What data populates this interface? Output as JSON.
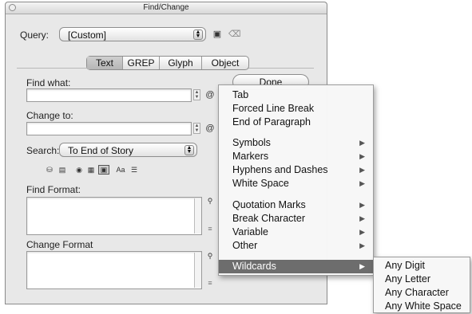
{
  "window": {
    "title": "Find/Change"
  },
  "query": {
    "label": "Query:",
    "value": "[Custom]"
  },
  "tabs": [
    {
      "label": "Text",
      "active": true
    },
    {
      "label": "GREP",
      "active": false
    },
    {
      "label": "Glyph",
      "active": false
    },
    {
      "label": "Object",
      "active": false
    }
  ],
  "find_what": {
    "label": "Find what:",
    "value": ""
  },
  "change_to": {
    "label": "Change to:",
    "value": ""
  },
  "search": {
    "label": "Search:",
    "value": "To End of Story"
  },
  "find_format": {
    "label": "Find Format:"
  },
  "change_format": {
    "label": "Change Format"
  },
  "buttons": {
    "done": "Done"
  },
  "option_icons": {
    "case_label": "Aa"
  },
  "special_menu": {
    "items": [
      {
        "label": "Tab",
        "submenu": false
      },
      {
        "label": "Forced Line Break",
        "submenu": false
      },
      {
        "label": "End of Paragraph",
        "submenu": false
      },
      {
        "label": "Symbols",
        "submenu": true
      },
      {
        "label": "Markers",
        "submenu": true
      },
      {
        "label": "Hyphens and Dashes",
        "submenu": true
      },
      {
        "label": "White Space",
        "submenu": true
      },
      {
        "label": "Quotation Marks",
        "submenu": true
      },
      {
        "label": "Break Character",
        "submenu": true
      },
      {
        "label": "Variable",
        "submenu": true
      },
      {
        "label": "Other",
        "submenu": true
      },
      {
        "label": "Wildcards",
        "submenu": true,
        "highlighted": true
      }
    ]
  },
  "wildcards_menu": {
    "items": [
      "Any Digit",
      "Any Letter",
      "Any Character",
      "Any White Space"
    ]
  },
  "colors": {
    "menu_highlight": "#6d6d6d",
    "window_bg": "#e8e8e8"
  }
}
